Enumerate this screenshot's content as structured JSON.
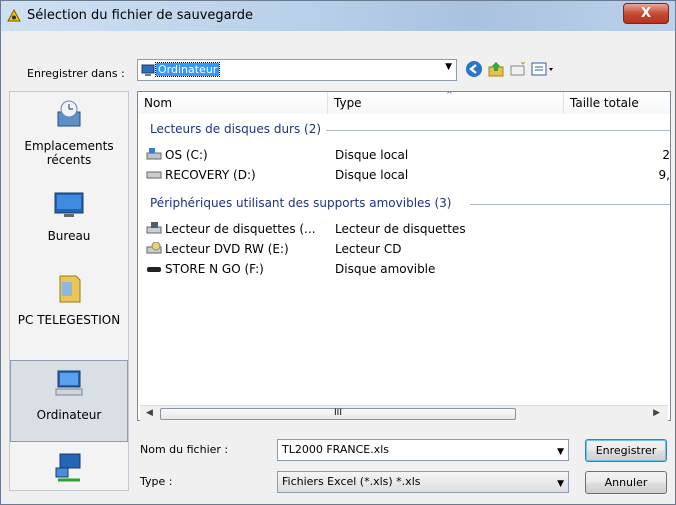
{
  "window": {
    "title": "Sélection du fichier de sauvegarde",
    "close_label": "X"
  },
  "toolbar": {
    "save_in_label": "Enregistrer dans :",
    "save_in_value": "Ordinateur"
  },
  "places": [
    {
      "label": "Emplacements récents",
      "icon": "recent-places-icon"
    },
    {
      "label": "Bureau",
      "icon": "desktop-icon"
    },
    {
      "label": "PC TELEGESTION",
      "icon": "user-folder-icon"
    },
    {
      "label": "Ordinateur",
      "icon": "computer-icon",
      "active": true
    },
    {
      "label": "",
      "icon": "network-icon"
    }
  ],
  "columns": {
    "name": "Nom",
    "type": "Type",
    "size": "Taille totale"
  },
  "groups": [
    {
      "title": "Lecteurs de disques durs (2)",
      "items": [
        {
          "name": "OS (C:)",
          "type": "Disque local",
          "size": "2"
        },
        {
          "name": "RECOVERY (D:)",
          "type": "Disque local",
          "size": "9,"
        }
      ]
    },
    {
      "title": "Périphériques utilisant des supports amovibles (3)",
      "items": [
        {
          "name": "Lecteur de disquettes (...",
          "type": "Lecteur de disquettes",
          "size": ""
        },
        {
          "name": "Lecteur DVD RW (E:)",
          "type": "Lecteur CD",
          "size": ""
        },
        {
          "name": "STORE N GO (F:)",
          "type": "Disque amovible",
          "size": ""
        }
      ]
    }
  ],
  "scroll_thumb_label": "III",
  "form": {
    "filename_label": "Nom du fichier :",
    "filename_value": "TL2000 FRANCE.xls",
    "type_label": "Type :",
    "type_value": "Fichiers Excel (*.xls) *.xls",
    "save_button": "Enregistrer",
    "cancel_button": "Annuler"
  }
}
